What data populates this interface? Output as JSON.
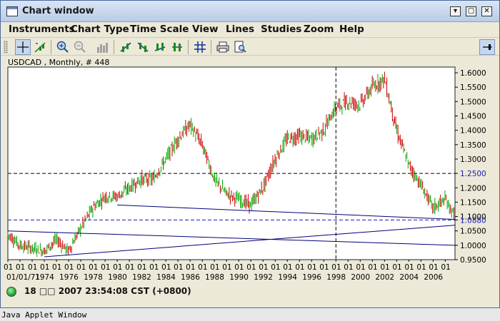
{
  "window": {
    "title": "Chart window",
    "buttons": [
      "minimize",
      "maximize",
      "close"
    ]
  },
  "menu": {
    "items": [
      "Instruments",
      "Chart Type",
      "Time Scale",
      "View",
      "Lines",
      "Studies",
      "Zoom",
      "Help"
    ]
  },
  "toolbar": {
    "buttons": [
      {
        "name": "crosshair-icon",
        "active": true
      },
      {
        "name": "draw-line-icon",
        "active": false
      },
      {
        "name": "zoom-in-icon",
        "active": false
      },
      {
        "name": "zoom-out-icon",
        "active": false
      },
      {
        "name": "bar-chart-icon",
        "active": false
      },
      {
        "name": "trend-up-icon",
        "active": false
      },
      {
        "name": "trend-down-icon",
        "active": false
      },
      {
        "name": "trend-cross-icon",
        "active": false
      },
      {
        "name": "trend-split-icon",
        "active": false
      },
      {
        "name": "grid-icon",
        "active": false
      },
      {
        "name": "print-icon",
        "active": false
      },
      {
        "name": "print-preview-icon",
        "active": false
      },
      {
        "name": "pin-icon",
        "active": false
      }
    ]
  },
  "chart": {
    "header": "USDCAD , Monthly, # 448",
    "y_ticks": [
      "1.6000",
      "1.5500",
      "1.5000",
      "1.4500",
      "1.4000",
      "1.3500",
      "1.3000",
      "1.2500",
      "1.2000",
      "1.1500",
      "1.1000",
      "1.0880",
      "1.0500",
      "1.0000",
      "0.9500"
    ],
    "highlight_levels": {
      "upper": "1.2500",
      "lower": "1.0880"
    },
    "x_month_label": "01",
    "x_year_labels": [
      "01/01/71",
      "1974",
      "1976",
      "1978",
      "1980",
      "1982",
      "1984",
      "1986",
      "1988",
      "1990",
      "1992",
      "1994",
      "1996",
      "1998",
      "2000",
      "2002",
      "2004",
      "2006"
    ],
    "colors": {
      "up": "#00aa00",
      "down": "#cc0000",
      "highlight": "#1a1aaa",
      "trendline": "#00007a"
    }
  },
  "chart_data": {
    "type": "candlestick",
    "title": "USDCAD , Monthly, # 448",
    "ylim": [
      0.95,
      1.62
    ],
    "x_range": [
      1971,
      2007.8
    ],
    "keypoints": [
      [
        1971.0,
        1.04
      ],
      [
        1972.0,
        1.0
      ],
      [
        1973.0,
        0.99
      ],
      [
        1974.0,
        0.98
      ],
      [
        1975.0,
        1.02
      ],
      [
        1976.0,
        0.98
      ],
      [
        1977.0,
        1.06
      ],
      [
        1978.0,
        1.13
      ],
      [
        1979.0,
        1.17
      ],
      [
        1980.0,
        1.17
      ],
      [
        1981.0,
        1.2
      ],
      [
        1982.0,
        1.23
      ],
      [
        1983.0,
        1.23
      ],
      [
        1984.0,
        1.3
      ],
      [
        1985.0,
        1.37
      ],
      [
        1986.0,
        1.42
      ],
      [
        1987.0,
        1.35
      ],
      [
        1988.0,
        1.23
      ],
      [
        1989.0,
        1.18
      ],
      [
        1990.0,
        1.16
      ],
      [
        1991.0,
        1.14
      ],
      [
        1992.0,
        1.2
      ],
      [
        1993.0,
        1.3
      ],
      [
        1994.0,
        1.37
      ],
      [
        1995.0,
        1.38
      ],
      [
        1996.0,
        1.37
      ],
      [
        1997.0,
        1.4
      ],
      [
        1998.0,
        1.48
      ],
      [
        1999.0,
        1.5
      ],
      [
        2000.0,
        1.49
      ],
      [
        2001.0,
        1.55
      ],
      [
        2002.0,
        1.58
      ],
      [
        2003.0,
        1.4
      ],
      [
        2004.0,
        1.28
      ],
      [
        2005.0,
        1.21
      ],
      [
        2006.0,
        1.13
      ],
      [
        2007.0,
        1.16
      ],
      [
        2007.8,
        1.1
      ]
    ],
    "horizontal_lines": [
      1.25,
      1.088
    ],
    "cursor_x": 1998.0,
    "trendlines": [
      {
        "from": [
          1980.0,
          1.14
        ],
        "to": [
          2007.8,
          1.09
        ]
      },
      {
        "from": [
          1971.0,
          1.05
        ],
        "to": [
          2007.8,
          1.0
        ]
      },
      {
        "from": [
          1974.0,
          0.96
        ],
        "to": [
          2007.8,
          1.07
        ]
      }
    ]
  },
  "status": {
    "text": "18 □□ 2007 23:54:08 CST (+0800)"
  },
  "applet": {
    "text": "Java Applet Window"
  }
}
